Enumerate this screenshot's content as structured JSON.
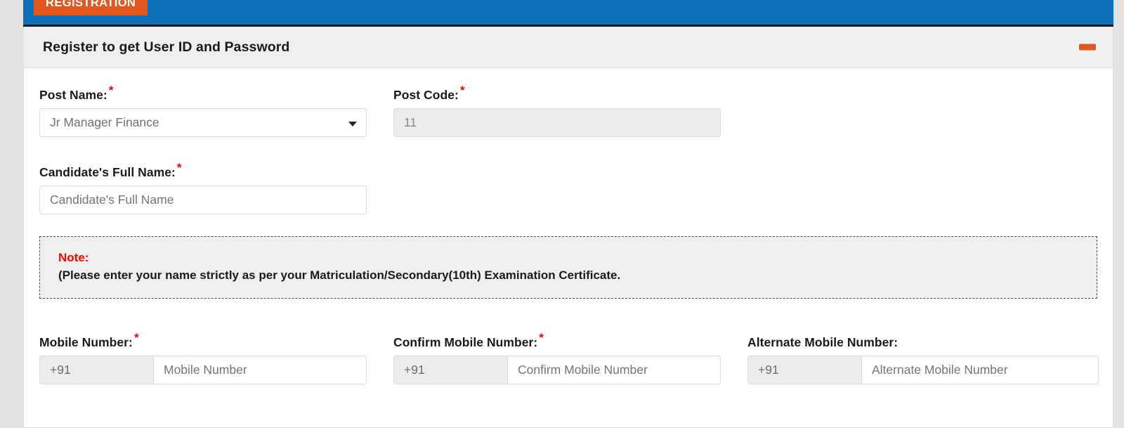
{
  "nav": {
    "active_tab": "REGISTRATION"
  },
  "panel": {
    "title": "Register to get User ID and Password",
    "collapse_icon": "minus-icon",
    "accent_color": "#e2571e",
    "header_bar_color": "#0c71b9"
  },
  "form": {
    "post_name": {
      "label": "Post Name:",
      "required": "*",
      "value": "Jr Manager Finance",
      "caret_icon": "chevron-down-icon"
    },
    "post_code": {
      "label": "Post Code:",
      "required": "*",
      "value": "11"
    },
    "candidate_name": {
      "label": "Candidate's Full Name:",
      "required": "*",
      "placeholder": "Candidate's Full Name",
      "value": ""
    },
    "note": {
      "title": "Note:",
      "text": "(Please enter your name strictly as per your Matriculation/Secondary(10th) Examination Certificate."
    },
    "mobile_number": {
      "label": "Mobile Number:",
      "required": "*",
      "prefix": "+91",
      "placeholder": "Mobile Number",
      "value": ""
    },
    "confirm_mobile_number": {
      "label": "Confirm Mobile Number:",
      "required": "*",
      "prefix": "+91",
      "placeholder": "Confirm Mobile Number",
      "value": ""
    },
    "alternate_mobile_number": {
      "label": "Alternate Mobile Number:",
      "required": "",
      "prefix": "+91",
      "placeholder": "Alternate Mobile Number",
      "value": ""
    }
  }
}
